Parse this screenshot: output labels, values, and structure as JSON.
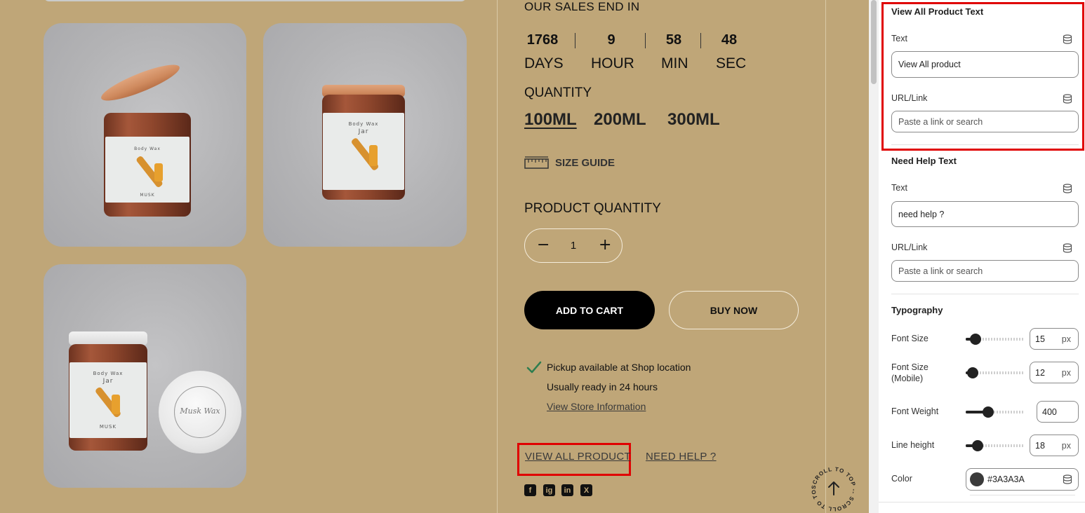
{
  "sales": {
    "title": "OUR SALES END IN",
    "countdown": [
      {
        "value": "1768",
        "unit": "DAYS"
      },
      {
        "value": "9",
        "unit": "HOUR"
      },
      {
        "value": "58",
        "unit": "MIN"
      },
      {
        "value": "48",
        "unit": "SEC"
      }
    ]
  },
  "quantity": {
    "title": "QUANTITY",
    "options": [
      "100ML",
      "200ML",
      "300ML"
    ],
    "selected": "100ML"
  },
  "size_guide": "SIZE GUIDE",
  "product_quantity": {
    "title": "PRODUCT QUANTITY",
    "minus": "−",
    "plus": "+",
    "value": "1"
  },
  "buttons": {
    "add_to_cart": "ADD TO CART",
    "buy_now": "BUY NOW"
  },
  "pickup": {
    "line1": "Pickup available at Shop location",
    "line2": "Usually ready in 24 hours",
    "store_link": "View Store Information"
  },
  "links": {
    "view_all": "VIEW ALL PRODUCT",
    "need_help": "NEED HELP ?"
  },
  "social": [
    "f",
    "ig",
    "in",
    "X"
  ],
  "jar_labels": {
    "brand": "Body Wax",
    "name": "Jar",
    "scent": "MUSK",
    "lid": "Musk Wax"
  },
  "scroll_to_top": "SCROLL TO TOP -- SCROLL TO TOP --",
  "panel": {
    "view_all_section": {
      "title": "View All Product Text",
      "text_label": "Text",
      "text_value": "View All product",
      "url_label": "URL/Link",
      "url_placeholder": "Paste a link or search"
    },
    "need_help_section": {
      "title": "Need Help Text",
      "text_label": "Text",
      "text_value": "need help ?",
      "url_label": "URL/Link",
      "url_placeholder": "Paste a link or search"
    },
    "typography": {
      "title": "Typography",
      "font_size": {
        "label": "Font Size",
        "value": "15",
        "unit": "px",
        "level": 0.17
      },
      "font_size_mobile": {
        "label": "Font Size (Mobile)",
        "value": "12",
        "unit": "px",
        "level": 0.12
      },
      "font_weight": {
        "label": "Font Weight",
        "value": "400",
        "level": 0.38
      },
      "line_height": {
        "label": "Line height",
        "value": "18",
        "unit": "px",
        "level": 0.2
      },
      "color": {
        "label": "Color",
        "value": "#3A3A3A"
      }
    }
  },
  "colors": {
    "page_bg": "#bfa678",
    "highlight": "#e00000",
    "accent_check": "#2e7d4f"
  }
}
